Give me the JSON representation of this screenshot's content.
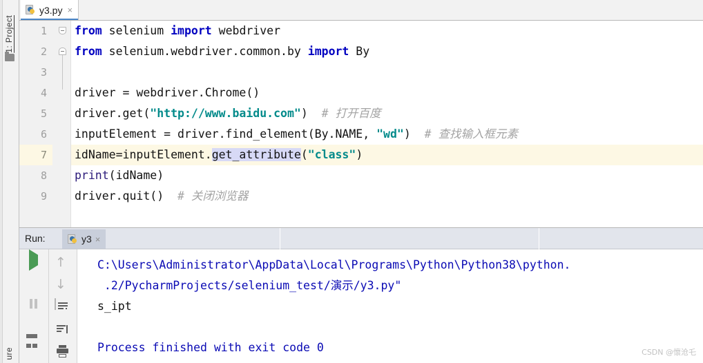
{
  "window": {
    "sidebar_project_label": "1: Project",
    "sidebar_structure_label": "ure",
    "folder_icon": "folder-icon"
  },
  "editor": {
    "tab": {
      "label": "y3.py",
      "close": "×",
      "icon": "python-file-icon"
    },
    "line_numbers": [
      "1",
      "2",
      "3",
      "4",
      "5",
      "6",
      "7",
      "8",
      "9"
    ],
    "highlighted_line": 7,
    "lines": [
      {
        "n": 1,
        "tokens": [
          {
            "t": "from",
            "c": "kw"
          },
          {
            "t": " selenium ",
            "c": "plain"
          },
          {
            "t": "import",
            "c": "kw"
          },
          {
            "t": " webdriver",
            "c": "plain"
          }
        ]
      },
      {
        "n": 2,
        "tokens": [
          {
            "t": "from",
            "c": "kw"
          },
          {
            "t": " selenium.webdriver.common.by ",
            "c": "plain"
          },
          {
            "t": "import",
            "c": "kw"
          },
          {
            "t": " By",
            "c": "plain"
          }
        ]
      },
      {
        "n": 3,
        "tokens": []
      },
      {
        "n": 4,
        "tokens": [
          {
            "t": "driver = webdriver.Chrome()",
            "c": "plain"
          }
        ]
      },
      {
        "n": 5,
        "tokens": [
          {
            "t": "driver.get(",
            "c": "plain"
          },
          {
            "t": "\"http://www.baidu.com\"",
            "c": "str"
          },
          {
            "t": ")  ",
            "c": "plain"
          },
          {
            "t": "# 打开百度",
            "c": "cmt"
          }
        ]
      },
      {
        "n": 6,
        "tokens": [
          {
            "t": "inputElement = driver.find_element(By.NAME, ",
            "c": "plain"
          },
          {
            "t": "\"wd\"",
            "c": "str"
          },
          {
            "t": ")  ",
            "c": "plain"
          },
          {
            "t": "# 查找输入框元素",
            "c": "cmt"
          }
        ]
      },
      {
        "n": 7,
        "tokens": [
          {
            "t": "idName=inputElement.",
            "c": "plain"
          },
          {
            "t": "get_attribute",
            "c": "plain sel"
          },
          {
            "t": "(",
            "c": "plain"
          },
          {
            "t": "\"class\"",
            "c": "str"
          },
          {
            "t": ")",
            "c": "plain"
          }
        ]
      },
      {
        "n": 8,
        "tokens": [
          {
            "t": "print",
            "c": "bi"
          },
          {
            "t": "(idName)",
            "c": "plain"
          }
        ]
      },
      {
        "n": 9,
        "tokens": [
          {
            "t": "driver.quit()  ",
            "c": "plain"
          },
          {
            "t": "# 关闭浏览器",
            "c": "cmt"
          }
        ]
      }
    ]
  },
  "run_panel": {
    "label": "Run:",
    "tab_label": "y3",
    "tab_close": "×",
    "tab_icon": "python-file-icon",
    "toolbar": [
      {
        "name": "rerun-button",
        "glyph": "run-triangle-icon"
      },
      {
        "name": "stop-button",
        "glyph": "stop-square-icon"
      },
      {
        "name": "pause-button",
        "glyph": "pause-icon"
      },
      {
        "name": "layout-settings-button",
        "glyph": "layout-icon"
      },
      {
        "name": "up-the-stack-trace-button",
        "glyph": "arrow-up-icon"
      },
      {
        "name": "down-the-stack-trace-button",
        "glyph": "arrow-down-icon"
      },
      {
        "name": "soft-wrap-button",
        "glyph": "soft-wrap-icon"
      },
      {
        "name": "scroll-to-end-button",
        "glyph": "scroll-to-end-icon"
      },
      {
        "name": "print-button",
        "glyph": "printer-icon"
      }
    ],
    "console": [
      {
        "text": "C:\\Users\\Administrator\\AppData\\Local\\Programs\\Python\\Python38\\python.",
        "color": "blue"
      },
      {
        "text": " .2/PycharmProjects/selenium_test/演示/y3.py\"",
        "color": "blue"
      },
      {
        "text": "s_ipt",
        "color": "black"
      },
      {
        "text": "",
        "color": "blue"
      },
      {
        "text": "Process finished with exit code 0",
        "color": "blue"
      }
    ]
  },
  "watermark": "CSDN @懷沧乇",
  "colors": {
    "keyword": "#0000c0",
    "string": "#048b8b",
    "comment": "#a3a3a3",
    "builtin": "#2b1a7a",
    "selection": "#d7d9f6",
    "current_line": "#fdf8e4",
    "console_blue": "#0a0ab4",
    "run_tabbar": "#e2e5ec",
    "run_icon_green": "#4a9b55"
  }
}
